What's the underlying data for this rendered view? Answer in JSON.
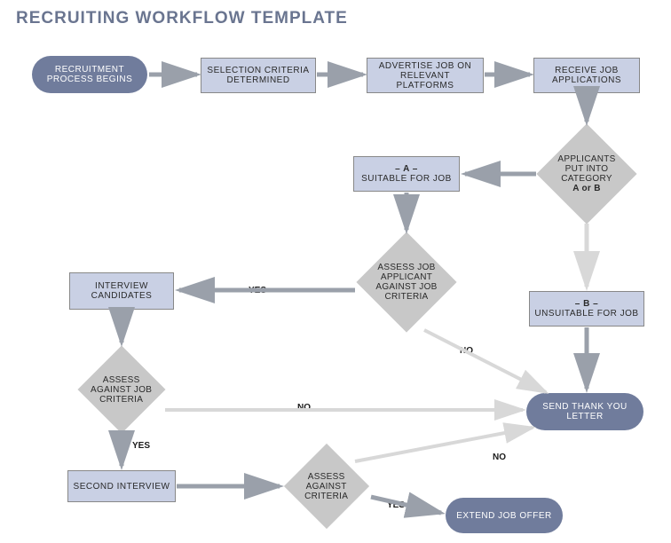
{
  "title": "RECRUITING WORKFLOW TEMPLATE",
  "nodes": {
    "start": "RECRUITMENT PROCESS BEGINS",
    "criteria": "SELECTION CRITERIA DETERMINED",
    "advertise": "ADVERTISE JOB ON RELEVANT PLATFORMS",
    "receive": "RECEIVE JOB APPLICATIONS",
    "categorize_l1": "APPLICANTS",
    "categorize_l2": "PUT INTO",
    "categorize_l3": "CATEGORY",
    "categorize_l4": "A or B",
    "catA_l1": "– A –",
    "catA_l2": "SUITABLE FOR JOB",
    "catB_l1": "– B –",
    "catB_l2": "UNSUITABLE FOR JOB",
    "assess1_l1": "ASSESS JOB",
    "assess1_l2": "APPLICANT",
    "assess1_l3": "AGAINST JOB",
    "assess1_l4": "CRITERIA",
    "interview": "INTERVIEW CANDIDATES",
    "assess2_l1": "ASSESS",
    "assess2_l2": "AGAINST JOB",
    "assess2_l3": "CRITERIA",
    "second": "SECOND INTERVIEW",
    "assess3_l1": "ASSESS",
    "assess3_l2": "AGAINST",
    "assess3_l3": "CRITERIA",
    "thankyou": "SEND THANK YOU LETTER",
    "offer": "EXTEND JOB OFFER"
  },
  "labels": {
    "yes": "YES",
    "no": "NO"
  },
  "colors": {
    "arrow_dark": "#9aa0aa",
    "arrow_light": "#d8d8d8"
  }
}
